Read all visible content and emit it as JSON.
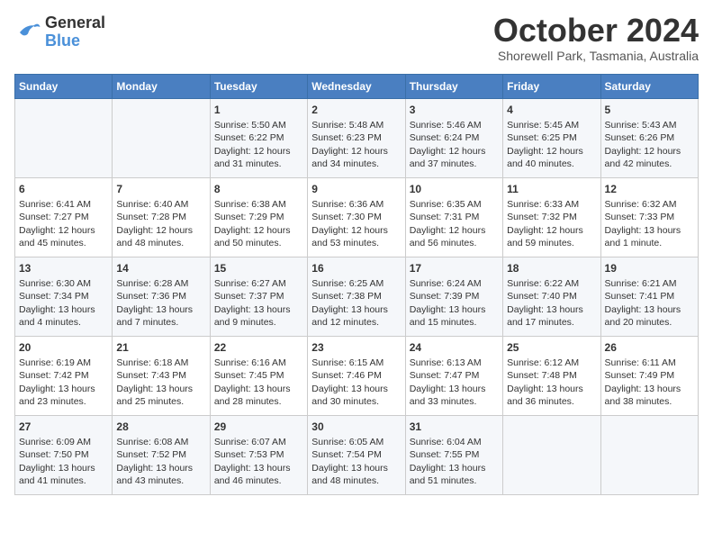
{
  "header": {
    "logo_line1": "General",
    "logo_line2": "Blue",
    "month_title": "October 2024",
    "location": "Shorewell Park, Tasmania, Australia"
  },
  "days_of_week": [
    "Sunday",
    "Monday",
    "Tuesday",
    "Wednesday",
    "Thursday",
    "Friday",
    "Saturday"
  ],
  "weeks": [
    [
      {
        "day": "",
        "content": ""
      },
      {
        "day": "",
        "content": ""
      },
      {
        "day": "1",
        "content": "Sunrise: 5:50 AM\nSunset: 6:22 PM\nDaylight: 12 hours and 31 minutes."
      },
      {
        "day": "2",
        "content": "Sunrise: 5:48 AM\nSunset: 6:23 PM\nDaylight: 12 hours and 34 minutes."
      },
      {
        "day": "3",
        "content": "Sunrise: 5:46 AM\nSunset: 6:24 PM\nDaylight: 12 hours and 37 minutes."
      },
      {
        "day": "4",
        "content": "Sunrise: 5:45 AM\nSunset: 6:25 PM\nDaylight: 12 hours and 40 minutes."
      },
      {
        "day": "5",
        "content": "Sunrise: 5:43 AM\nSunset: 6:26 PM\nDaylight: 12 hours and 42 minutes."
      }
    ],
    [
      {
        "day": "6",
        "content": "Sunrise: 6:41 AM\nSunset: 7:27 PM\nDaylight: 12 hours and 45 minutes."
      },
      {
        "day": "7",
        "content": "Sunrise: 6:40 AM\nSunset: 7:28 PM\nDaylight: 12 hours and 48 minutes."
      },
      {
        "day": "8",
        "content": "Sunrise: 6:38 AM\nSunset: 7:29 PM\nDaylight: 12 hours and 50 minutes."
      },
      {
        "day": "9",
        "content": "Sunrise: 6:36 AM\nSunset: 7:30 PM\nDaylight: 12 hours and 53 minutes."
      },
      {
        "day": "10",
        "content": "Sunrise: 6:35 AM\nSunset: 7:31 PM\nDaylight: 12 hours and 56 minutes."
      },
      {
        "day": "11",
        "content": "Sunrise: 6:33 AM\nSunset: 7:32 PM\nDaylight: 12 hours and 59 minutes."
      },
      {
        "day": "12",
        "content": "Sunrise: 6:32 AM\nSunset: 7:33 PM\nDaylight: 13 hours and 1 minute."
      }
    ],
    [
      {
        "day": "13",
        "content": "Sunrise: 6:30 AM\nSunset: 7:34 PM\nDaylight: 13 hours and 4 minutes."
      },
      {
        "day": "14",
        "content": "Sunrise: 6:28 AM\nSunset: 7:36 PM\nDaylight: 13 hours and 7 minutes."
      },
      {
        "day": "15",
        "content": "Sunrise: 6:27 AM\nSunset: 7:37 PM\nDaylight: 13 hours and 9 minutes."
      },
      {
        "day": "16",
        "content": "Sunrise: 6:25 AM\nSunset: 7:38 PM\nDaylight: 13 hours and 12 minutes."
      },
      {
        "day": "17",
        "content": "Sunrise: 6:24 AM\nSunset: 7:39 PM\nDaylight: 13 hours and 15 minutes."
      },
      {
        "day": "18",
        "content": "Sunrise: 6:22 AM\nSunset: 7:40 PM\nDaylight: 13 hours and 17 minutes."
      },
      {
        "day": "19",
        "content": "Sunrise: 6:21 AM\nSunset: 7:41 PM\nDaylight: 13 hours and 20 minutes."
      }
    ],
    [
      {
        "day": "20",
        "content": "Sunrise: 6:19 AM\nSunset: 7:42 PM\nDaylight: 13 hours and 23 minutes."
      },
      {
        "day": "21",
        "content": "Sunrise: 6:18 AM\nSunset: 7:43 PM\nDaylight: 13 hours and 25 minutes."
      },
      {
        "day": "22",
        "content": "Sunrise: 6:16 AM\nSunset: 7:45 PM\nDaylight: 13 hours and 28 minutes."
      },
      {
        "day": "23",
        "content": "Sunrise: 6:15 AM\nSunset: 7:46 PM\nDaylight: 13 hours and 30 minutes."
      },
      {
        "day": "24",
        "content": "Sunrise: 6:13 AM\nSunset: 7:47 PM\nDaylight: 13 hours and 33 minutes."
      },
      {
        "day": "25",
        "content": "Sunrise: 6:12 AM\nSunset: 7:48 PM\nDaylight: 13 hours and 36 minutes."
      },
      {
        "day": "26",
        "content": "Sunrise: 6:11 AM\nSunset: 7:49 PM\nDaylight: 13 hours and 38 minutes."
      }
    ],
    [
      {
        "day": "27",
        "content": "Sunrise: 6:09 AM\nSunset: 7:50 PM\nDaylight: 13 hours and 41 minutes."
      },
      {
        "day": "28",
        "content": "Sunrise: 6:08 AM\nSunset: 7:52 PM\nDaylight: 13 hours and 43 minutes."
      },
      {
        "day": "29",
        "content": "Sunrise: 6:07 AM\nSunset: 7:53 PM\nDaylight: 13 hours and 46 minutes."
      },
      {
        "day": "30",
        "content": "Sunrise: 6:05 AM\nSunset: 7:54 PM\nDaylight: 13 hours and 48 minutes."
      },
      {
        "day": "31",
        "content": "Sunrise: 6:04 AM\nSunset: 7:55 PM\nDaylight: 13 hours and 51 minutes."
      },
      {
        "day": "",
        "content": ""
      },
      {
        "day": "",
        "content": ""
      }
    ]
  ]
}
